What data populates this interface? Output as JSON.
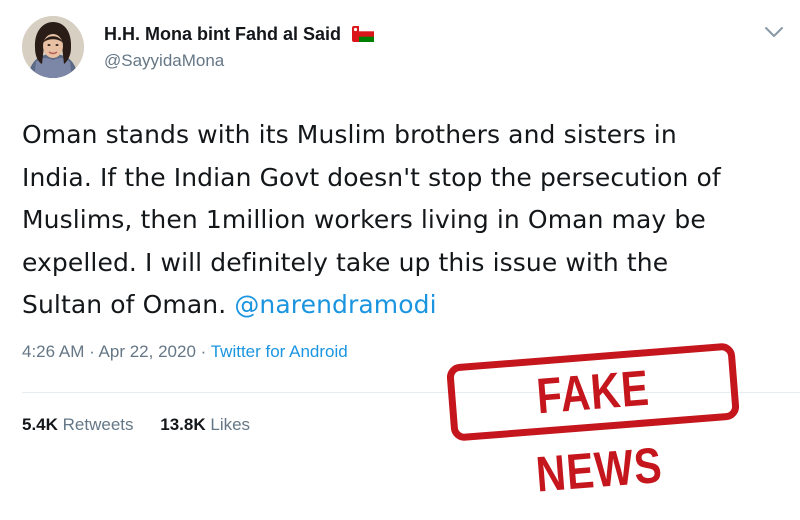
{
  "author": {
    "name": "H.H. Mona bint Fahd al Said",
    "handle": "@SayyidaMona",
    "flag_icon": "oman-flag-icon"
  },
  "tweet": {
    "lines": [
      "Oman stands with its Muslim brothers and sisters in",
      "India. If the Indian Govt doesn't stop the persecution of",
      "Muslims, then 1million workers living in Oman may be",
      "expelled. I will definitely take up this issue with the",
      "Sultan of Oman. "
    ],
    "mention": "@narendramodi"
  },
  "meta": {
    "time": "4:26 AM",
    "separator": " · ",
    "date": "Apr 22, 2020",
    "source": "Twitter for Android"
  },
  "stats": {
    "retweets_count": "5.4K",
    "retweets_label": "Retweets",
    "likes_count": "13.8K",
    "likes_label": "Likes"
  },
  "stamp": {
    "text": "FAKE NEWS"
  },
  "colors": {
    "link": "#1b95e0",
    "muted": "#657786",
    "stamp": "#c4161c"
  }
}
